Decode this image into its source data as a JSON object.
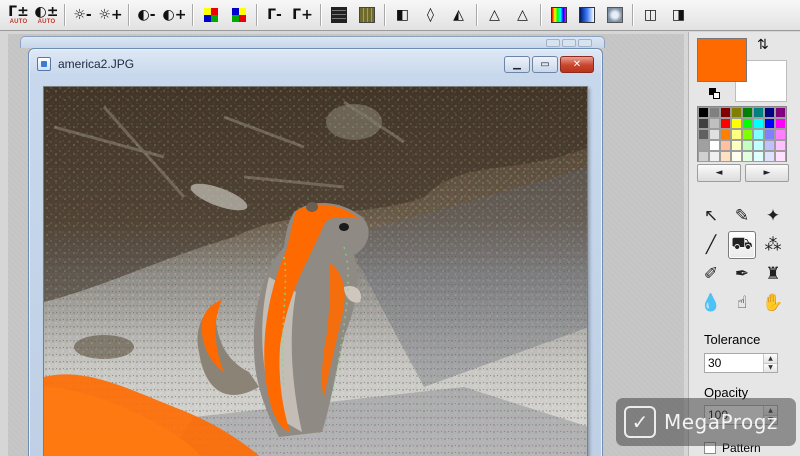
{
  "toolbar": {
    "groups": [
      [
        {
          "name": "auto-levels-button",
          "glyph": "Γ±",
          "sub": "AUTO"
        },
        {
          "name": "auto-contrast-button",
          "glyph": "◐±",
          "sub": "AUTO"
        }
      ],
      [
        {
          "name": "brightness-decrease-button",
          "glyph": "☼-"
        },
        {
          "name": "brightness-increase-button",
          "glyph": "☼+"
        }
      ],
      [
        {
          "name": "contrast-decrease-button",
          "glyph": "◐-"
        },
        {
          "name": "contrast-increase-button",
          "glyph": "◐+"
        }
      ],
      [
        {
          "name": "saturation-decrease-button",
          "glyph": "",
          "swatch": "rgb-minus"
        },
        {
          "name": "saturation-increase-button",
          "glyph": "",
          "swatch": "rgb-plus"
        }
      ],
      [
        {
          "name": "gamma-decrease-button",
          "glyph": "Γ-"
        },
        {
          "name": "gamma-increase-button",
          "glyph": "Γ+"
        }
      ],
      [
        {
          "name": "mosaic-filter-button",
          "glyph": "",
          "swatch": "grid-dark"
        },
        {
          "name": "texture-filter-button",
          "glyph": "",
          "swatch": "grid-olive"
        }
      ],
      [
        {
          "name": "mirror-button",
          "glyph": "◧"
        },
        {
          "name": "blur-button",
          "glyph": "◊"
        },
        {
          "name": "sharpen-button",
          "glyph": "◭"
        }
      ],
      [
        {
          "name": "emboss-button",
          "glyph": "△"
        },
        {
          "name": "edge-detect-button",
          "glyph": "△"
        }
      ],
      [
        {
          "name": "color-balance-button",
          "glyph": "",
          "swatch": "rainbow"
        },
        {
          "name": "gradient-button",
          "glyph": "",
          "swatch": "blue-grad"
        },
        {
          "name": "effects-button",
          "glyph": "",
          "swatch": "sparkle"
        }
      ],
      [
        {
          "name": "page-split-button",
          "glyph": "◫"
        },
        {
          "name": "page-view-button",
          "glyph": "◨"
        }
      ]
    ]
  },
  "document": {
    "title": "america2.JPG",
    "minimize_glyph": "▁",
    "restore_glyph": "▭",
    "close_glyph": "✕"
  },
  "colors": {
    "foreground": "#ff6a00",
    "background": "#ffffff",
    "swap_glyph": "⇅",
    "palette": [
      "#000000",
      "#808080",
      "#800000",
      "#808000",
      "#008000",
      "#008080",
      "#000080",
      "#800080",
      "#404040",
      "#c0c0c0",
      "#ff0000",
      "#ffff00",
      "#00ff00",
      "#00ffff",
      "#0000ff",
      "#ff00ff",
      "#606060",
      "#e0e0e0",
      "#ff8000",
      "#ffff80",
      "#80ff00",
      "#80ffff",
      "#8080ff",
      "#ff80ff",
      "#a0a0a0",
      "#ffffff",
      "#ffc0a0",
      "#ffffc0",
      "#c0ffc0",
      "#c0ffff",
      "#c0c0ff",
      "#ffc0ff",
      "#d0d0d0",
      "#f0f0f0",
      "#ffe0c0",
      "#fffff0",
      "#e0ffe0",
      "#e0ffff",
      "#e0e0ff",
      "#ffe0ff"
    ],
    "prev_glyph": "◄",
    "next_glyph": "►"
  },
  "tools": [
    {
      "name": "select-tool",
      "glyph": "↖",
      "active": false
    },
    {
      "name": "eyedropper-tool",
      "glyph": "✎",
      "active": false
    },
    {
      "name": "magic-wand-tool",
      "glyph": "✦",
      "active": false
    },
    {
      "name": "line-tool",
      "glyph": "╱",
      "active": false
    },
    {
      "name": "paint-bucket-tool",
      "glyph": "⛟",
      "active": true
    },
    {
      "name": "spray-tool",
      "glyph": "⁂",
      "active": false
    },
    {
      "name": "brush-tool",
      "glyph": "✐",
      "active": false
    },
    {
      "name": "pen-tool",
      "glyph": "✒",
      "active": false
    },
    {
      "name": "stamp-tool",
      "glyph": "♜",
      "active": false
    },
    {
      "name": "drop-tool",
      "glyph": "💧",
      "active": false
    },
    {
      "name": "smudge-tool",
      "glyph": "☝",
      "active": false
    },
    {
      "name": "hand-tool",
      "glyph": "✋",
      "active": false
    }
  ],
  "options": {
    "tolerance_label": "Tolerance",
    "tolerance_value": "30",
    "opacity_label": "Opacity",
    "opacity_value": "100",
    "pattern_label": "Pattern",
    "spin_up": "▲",
    "spin_down": "▼"
  },
  "watermark": {
    "logo_glyph": "✓",
    "text": "MegaProgz"
  }
}
